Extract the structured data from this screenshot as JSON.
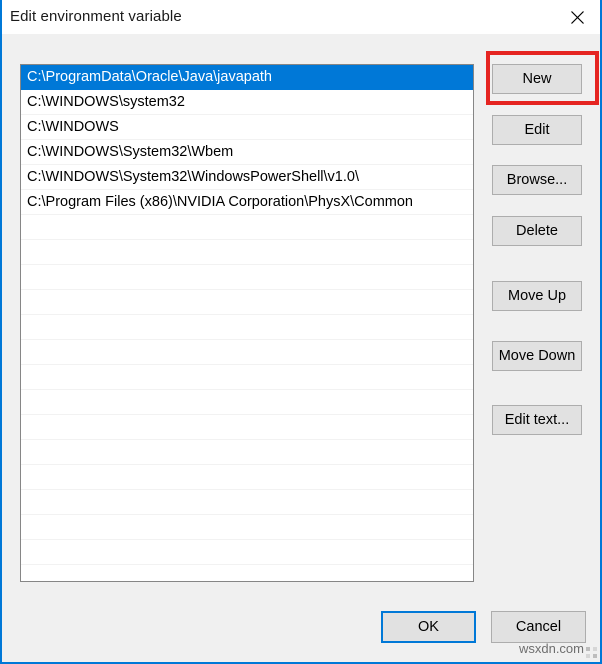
{
  "window": {
    "title": "Edit environment variable",
    "close_icon": "close-icon"
  },
  "path_list": {
    "items": [
      "C:\\ProgramData\\Oracle\\Java\\javapath",
      "C:\\WINDOWS\\system32",
      "C:\\WINDOWS",
      "C:\\WINDOWS\\System32\\Wbem",
      "C:\\WINDOWS\\System32\\WindowsPowerShell\\v1.0\\",
      "C:\\Program Files (x86)\\NVIDIA Corporation\\PhysX\\Common"
    ],
    "selected_index": 0,
    "empty_row_count": 14,
    "selection_color": "#0078d7"
  },
  "side_buttons": {
    "new": "New",
    "edit": "Edit",
    "browse": "Browse...",
    "delete": "Delete",
    "move_up": "Move Up",
    "move_down": "Move Down",
    "edit_text": "Edit text..."
  },
  "annotation": {
    "target": "new",
    "color": "#e52421"
  },
  "footer_buttons": {
    "ok": "OK",
    "cancel": "Cancel",
    "focused": "ok",
    "focus_color": "#0078d7"
  },
  "watermark": {
    "text": "wsxdn.com"
  }
}
